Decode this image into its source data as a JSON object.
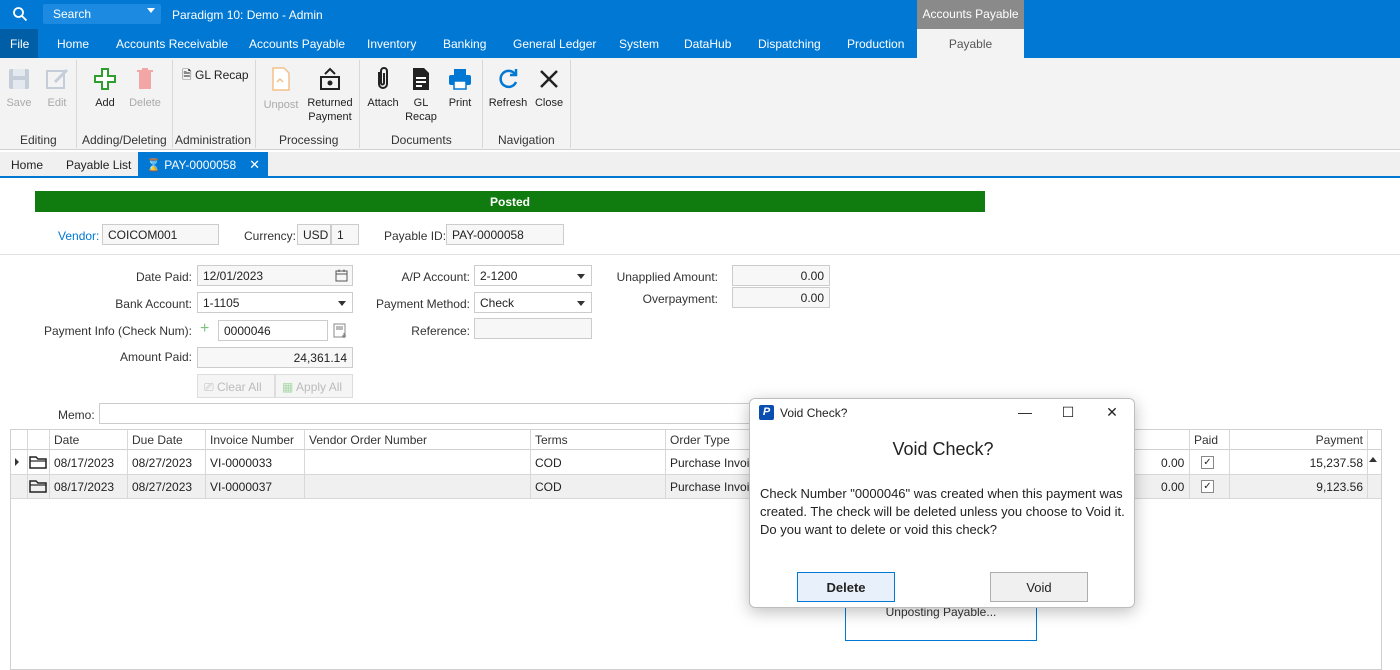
{
  "titlebar": {
    "search_placeholder": "Search",
    "app_title": "Paradigm 10: Demo - Admin",
    "context_tab_title": "Accounts Payable"
  },
  "menu": {
    "file": "File",
    "items": [
      "Home",
      "Accounts Receivable",
      "Accounts Payable",
      "Inventory",
      "Banking",
      "General Ledger",
      "System",
      "DataHub",
      "Dispatching",
      "Production"
    ],
    "active": "Payable"
  },
  "ribbon": {
    "save": "Save",
    "edit": "Edit",
    "add": "Add",
    "delete": "Delete",
    "gl_recap_small": "GL Recap",
    "unpost": "Unpost",
    "returned_payment": "Returned Payment",
    "attach": "Attach",
    "gl_recap": "GL Recap",
    "print": "Print",
    "refresh": "Refresh",
    "close": "Close",
    "groups": {
      "editing": "Editing",
      "adding_deleting": "Adding/Deleting",
      "administration": "Administration",
      "processing": "Processing",
      "documents": "Documents",
      "navigation": "Navigation"
    }
  },
  "tabs": {
    "home": "Home",
    "payable_list": "Payable List",
    "active": "PAY-0000058",
    "close": "✕"
  },
  "form": {
    "status": "Posted",
    "vendor_label": "Vendor:",
    "vendor": "COICOM001",
    "currency_label": "Currency:",
    "currency": "USD",
    "currency_rate": "1",
    "payable_id_label": "Payable ID:",
    "payable_id": "PAY-0000058",
    "date_paid_label": "Date Paid:",
    "date_paid": "12/01/2023",
    "bank_account_label": "Bank Account:",
    "bank_account": "1-1105",
    "payment_info_label": "Payment Info (Check Num):",
    "check_num": "0000046",
    "amount_paid_label": "Amount Paid:",
    "amount_paid": "24,361.14",
    "ap_account_label": "A/P Account:",
    "ap_account": "2-1200",
    "payment_method_label": "Payment Method:",
    "payment_method": "Check",
    "reference_label": "Reference:",
    "reference": "",
    "unapplied_label": "Unapplied Amount:",
    "unapplied": "0.00",
    "overpayment_label": "Overpayment:",
    "overpayment": "0.00",
    "clear_all": "Clear All",
    "apply_all": "Apply All",
    "memo_label": "Memo:"
  },
  "grid": {
    "headers": {
      "date": "Date",
      "due_date": "Due Date",
      "invoice_number": "Invoice Number",
      "vendor_order_number": "Vendor Order Number",
      "terms": "Terms",
      "order_type": "Order Type",
      "paid": "Paid",
      "payment": "Payment"
    },
    "rows": [
      {
        "date": "08/17/2023",
        "due_date": "08/27/2023",
        "invoice": "VI-0000033",
        "vendor_order": "",
        "terms": "COD",
        "order_type": "Purchase Invoic",
        "amount": "0.00",
        "paid": "✓",
        "payment": "15,237.58"
      },
      {
        "date": "08/17/2023",
        "due_date": "08/27/2023",
        "invoice": "VI-0000037",
        "vendor_order": "",
        "terms": "COD",
        "order_type": "Purchase Invoic",
        "amount": "0.00",
        "paid": "✓",
        "payment": "9,123.56"
      }
    ]
  },
  "unposting": "Unposting Payable...",
  "dialog": {
    "window_title": "Void Check?",
    "heading": "Void Check?",
    "line1": "Check Number \"0000046\" was created when this payment was created.  The check will be deleted unless you choose to Void it.",
    "line2": "Do you want to delete or void this check?",
    "delete": "Delete",
    "void": "Void",
    "minimize": "—",
    "maximize": "☐",
    "close": "✕"
  }
}
